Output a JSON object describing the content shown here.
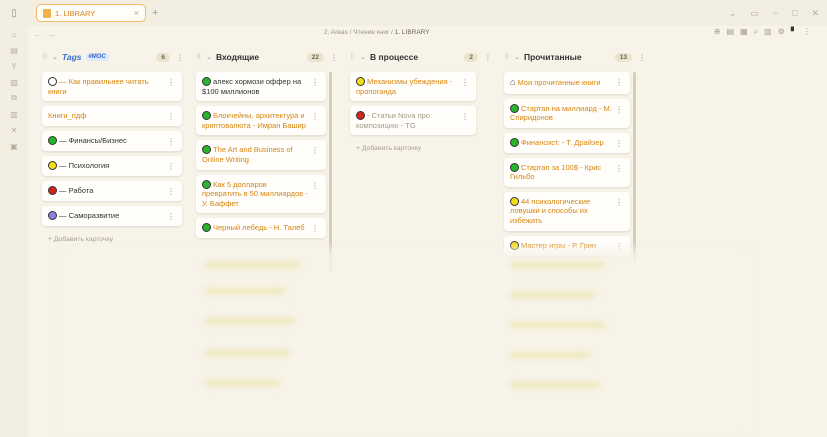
{
  "tab": {
    "label": "1. LIBRARY",
    "close": "×",
    "new": "+"
  },
  "breadcrumb": {
    "part1": "2. Areas",
    "sep": "/",
    "part2": "Чтение книг",
    "part3": "1. LIBRARY"
  },
  "columns": [
    {
      "title": "Tags",
      "tag": "#MOC",
      "count": "6",
      "cards": [
        {
          "dot": "white",
          "text": "— Как правильнее читать книги",
          "color": "link"
        },
        {
          "dot": "",
          "text": "Книги_пдф",
          "color": "link"
        },
        {
          "dot": "green",
          "text": "— Финансы/Бизнес",
          "color": "plain"
        },
        {
          "dot": "yellow",
          "text": "— Психология",
          "color": "plain"
        },
        {
          "dot": "red",
          "text": "— Работа",
          "color": "plain"
        },
        {
          "dot": "purple",
          "text": "— Саморазвитие",
          "color": "plain"
        }
      ],
      "add": "+ Добавить карточку"
    },
    {
      "title": "Входящие",
      "count": "22",
      "cards": [
        {
          "dot": "green",
          "text": "алекс хормози оффер на $100 миллионов",
          "color": "plain"
        },
        {
          "dot": "green",
          "text": "Блокчейны, архитектура и криптовалюта - Имран Башир",
          "color": "link"
        },
        {
          "dot": "green",
          "text": "The Art and Business of Online Writing",
          "color": "link"
        },
        {
          "dot": "green",
          "text": "Как 5 долларов превратить в 50 миллиардов - У. Баффет",
          "color": "link"
        },
        {
          "dot": "green",
          "text": "Черный лебедь - Н. Талеб",
          "color": "link"
        }
      ]
    },
    {
      "title": "В процессе",
      "count": "2",
      "cards": [
        {
          "dot": "yellow",
          "text": "Механизмы убеждения - пропоганда",
          "color": "link"
        },
        {
          "dot": "red",
          "text": "- Статьи Nova про композицию - TG",
          "color": "muted"
        }
      ],
      "add": "+ Добавить карточку"
    },
    {
      "title": "Прочитанные",
      "count": "13",
      "cards": [
        {
          "dot": "home",
          "text": "Мои прочитанные книги",
          "color": "link"
        },
        {
          "dot": "green",
          "text": "Стартап на миллиард - М. Спиридонов",
          "color": "link"
        },
        {
          "dot": "green",
          "text": "Финансист. - Т. Драйзер",
          "color": "link"
        },
        {
          "dot": "green",
          "text": "Стартап за 100$ - Крис Гильбо",
          "color": "link"
        },
        {
          "dot": "yellow",
          "text": "44 психологические ловушки и способы их избежать",
          "color": "link"
        },
        {
          "dot": "yellow",
          "text": "Мастер игры - Р. Грин",
          "color": "link"
        }
      ]
    }
  ],
  "icons": {
    "sidebar_toggle": "sidebar-toggle-icon",
    "tab_file": "kanban-file-icon",
    "more": "more-vertical-icon",
    "grip": "drag-handle-icon",
    "chevron": "chevron-down-icon"
  },
  "colors": {
    "accent": "#d78512",
    "tag": "#3a6fd0",
    "background": "#f7f3e9"
  }
}
